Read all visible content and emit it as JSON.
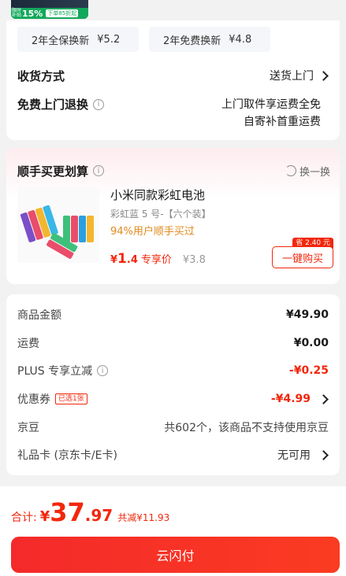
{
  "promo": {
    "mini_text": "限时补贴",
    "percent": "15%",
    "tag": "下单85折起"
  },
  "service": {
    "options": [
      {
        "label": "2年全保换新",
        "price": "¥5.2"
      },
      {
        "label": "2年免费换新",
        "price": "¥4.8"
      }
    ],
    "delivery_label": "收货方式",
    "delivery_value": "送货上门",
    "return_label": "免费上门退换",
    "return_info_icon": "i",
    "return_desc_line1": "上门取件享运费全免",
    "return_desc_line2": "自寄补首重运费"
  },
  "addon": {
    "title": "顺手买更划算",
    "info_icon": "i",
    "swap_label": "换一换",
    "product_name": "小米同款彩虹电池",
    "product_spec": "彩虹蓝 5 号-【六个装】",
    "product_hint": "94%用户顺手买过",
    "price_symbol": "¥",
    "price_int": "1",
    "price_dec": ".4",
    "price_tag": "专享价",
    "orig_price": "¥3.8",
    "save_badge": "省 2.40 元",
    "buy_label": "一键购买"
  },
  "fees": {
    "rows": [
      {
        "label": "商品金额",
        "value": "¥49.90"
      },
      {
        "label": "运费",
        "value": "¥0.00"
      },
      {
        "label": "PLUS 专享立减",
        "value": "-¥0.25"
      },
      {
        "label": "优惠券",
        "tag": "已选1张",
        "value": "-¥4.99"
      },
      {
        "label": "京豆",
        "value": "共602个，该商品不支持使用京豆"
      },
      {
        "label": "礼品卡 (京东卡/E卡)",
        "value": "无可用"
      }
    ],
    "plus_info_icon": "i"
  },
  "bottom": {
    "total_label": "合计:",
    "total_yuan": "¥",
    "total_int": "37",
    "total_dec": ".97",
    "total_save": "共减¥11.93",
    "pay_label": "云闪付"
  },
  "colors": {
    "accent": "#f2270c",
    "coupon_orange": "#e08a1e",
    "background": "#f2f2f2"
  },
  "icons": [
    "info-icon",
    "chevron-right-icon",
    "refresh-icon"
  ]
}
